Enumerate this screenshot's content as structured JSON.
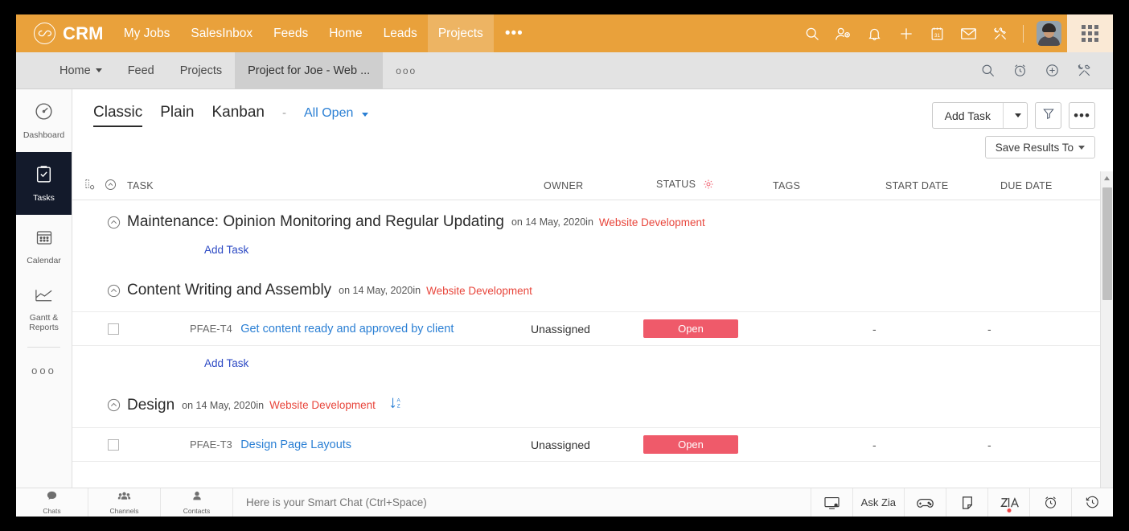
{
  "topbar": {
    "brand": "CRM",
    "brand_icon": "infinity-loop-icon",
    "nav": [
      {
        "label": "My Jobs",
        "active": false
      },
      {
        "label": "SalesInbox",
        "active": false
      },
      {
        "label": "Feeds",
        "active": false
      },
      {
        "label": "Home",
        "active": false
      },
      {
        "label": "Leads",
        "active": false
      },
      {
        "label": "Projects",
        "active": true
      }
    ],
    "more_label": "•••",
    "actions": [
      "search-icon",
      "add-user-icon",
      "bell-icon",
      "plus-icon",
      "calendar-icon",
      "mail-icon",
      "tools-icon"
    ],
    "calendar_day": "31",
    "accent_color": "#e9a13b",
    "active_tab_color": "#edb463",
    "launcher_bg": "#fae9d5"
  },
  "tabbar": {
    "tabs": [
      {
        "label": "Home",
        "caret": true,
        "active": false
      },
      {
        "label": "Feed",
        "caret": false,
        "active": false
      },
      {
        "label": "Projects",
        "caret": false,
        "active": false
      },
      {
        "label": "Project for Joe - Web ...",
        "caret": false,
        "active": true
      }
    ],
    "more_label": "ooo",
    "icons": [
      "search-icon",
      "alarm-clock-icon",
      "plus-circle-icon",
      "tools-icon"
    ]
  },
  "sidebar": {
    "items": [
      {
        "label": "Dashboard",
        "icon": "gauge-icon",
        "active": false
      },
      {
        "label": "Tasks",
        "icon": "clipboard-check-icon",
        "active": true
      },
      {
        "label": "Calendar",
        "icon": "calendar-icon",
        "active": false
      },
      {
        "label": "Gantt & Reports",
        "icon": "chart-icon",
        "active": false
      }
    ],
    "more_label": "ooo",
    "active_bg": "#131a2b"
  },
  "toolbar": {
    "views": [
      {
        "label": "Classic",
        "active": true
      },
      {
        "label": "Plain",
        "active": false
      },
      {
        "label": "Kanban",
        "active": false
      }
    ],
    "separator": "-",
    "filter_label": "All Open",
    "filter_color": "#2a7fd4",
    "add_task_label": "Add Task",
    "filter_icon": "funnel-icon",
    "more_icon": "ellipsis-icon",
    "save_results_label": "Save Results To"
  },
  "table": {
    "header_icons": [
      "column-settings-icon",
      "collapse-all-icon"
    ],
    "columns": [
      "TASK",
      "OWNER",
      "STATUS",
      "TAGS",
      "START DATE",
      "DUE DATE"
    ],
    "status_gear_icon": "gear-icon",
    "status_gear_color": "#ef5a6a",
    "add_task_label": "Add Task",
    "groups": [
      {
        "name": "Maintenance: Opinion Monitoring and Regular Updating",
        "meta": "on 14 May, 2020in",
        "project": "Website Development",
        "sort_icon": false,
        "tasks": []
      },
      {
        "name": "Content Writing and Assembly",
        "meta": "on 14 May, 2020in",
        "project": "Website Development",
        "sort_icon": false,
        "tasks": [
          {
            "id": "PFAE-T4",
            "name": "Get content ready and approved by client",
            "owner": "Unassigned",
            "status": "Open",
            "status_color": "#ef5a6a",
            "tags": "",
            "start_date": "-",
            "due_date": "-"
          }
        ]
      },
      {
        "name": "Design",
        "meta": "on 14 May, 2020in",
        "project": "Website Development",
        "sort_icon": true,
        "sort_icon_name": "sort-az-icon",
        "tasks": [
          {
            "id": "PFAE-T3",
            "name": "Design Page Layouts",
            "owner": "Unassigned",
            "status": "Open",
            "status_color": "#ef5a6a",
            "tags": "",
            "start_date": "-",
            "due_date": "-"
          }
        ]
      }
    ]
  },
  "chatbar": {
    "items": [
      {
        "label": "Chats",
        "icon": "chat-bubble-icon"
      },
      {
        "label": "Channels",
        "icon": "people-icon"
      },
      {
        "label": "Contacts",
        "icon": "person-icon"
      }
    ],
    "placeholder": "Here is your Smart Chat (Ctrl+Space)",
    "right": [
      {
        "label": "",
        "icon": "screen-share-icon"
      },
      {
        "label": "Ask Zia",
        "icon": ""
      },
      {
        "label": "",
        "icon": "gamepad-icon"
      },
      {
        "label": "",
        "icon": "sticky-note-icon"
      },
      {
        "label": "",
        "icon": "zia-logo-icon",
        "dot": true
      },
      {
        "label": "",
        "icon": "alarm-clock-icon"
      },
      {
        "label": "",
        "icon": "history-icon"
      }
    ]
  }
}
